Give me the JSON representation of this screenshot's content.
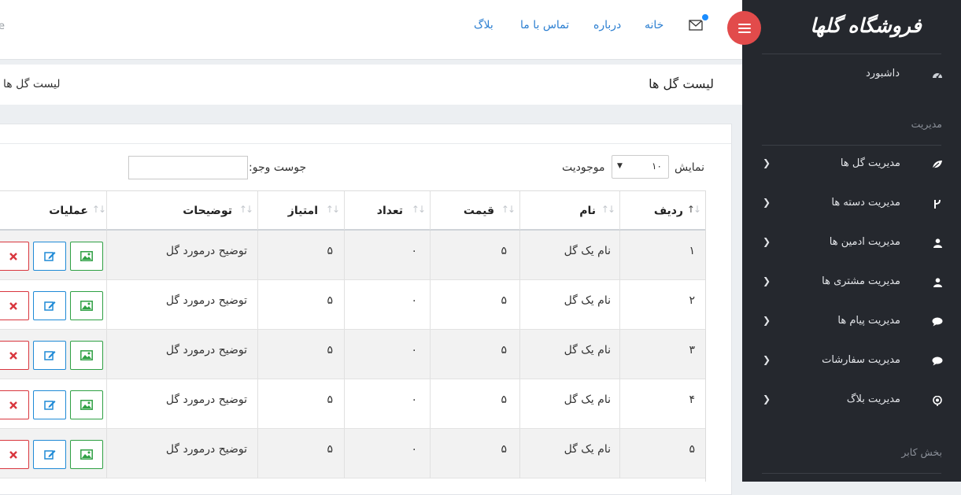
{
  "brand": {
    "name": "فروشگاه گلها"
  },
  "sidebar": {
    "dashboard": "داشبورد",
    "section_manage": "مدیریت",
    "items": [
      {
        "label": "مدیریت گل ها",
        "icon": "leaf-icon"
      },
      {
        "label": "مدیریت دسته ها",
        "icon": "fork-icon"
      },
      {
        "label": "مدیریت ادمین ها",
        "icon": "user-icon"
      },
      {
        "label": "مدیریت مشتری ها",
        "icon": "user-icon"
      },
      {
        "label": "مدیریت پیام ها",
        "icon": "chat-bubble-icon"
      },
      {
        "label": "مدیریت سفارشات",
        "icon": "chat-bubble-icon"
      },
      {
        "label": "مدیریت بلاگ",
        "icon": "location-pin-icon"
      }
    ],
    "section_user": "بخش کابر"
  },
  "topbar": {
    "nav": [
      "خانه",
      "درباره",
      "تماس با ما",
      "بلاگ"
    ],
    "search_fragment": "e"
  },
  "page": {
    "title": "لیست گل ها",
    "breadcrumb": "لیست گل ها"
  },
  "table_controls": {
    "show": "نمایش",
    "length_value": "۱۰",
    "entries": "موجودیت",
    "search_label": "جوست وجو:"
  },
  "table": {
    "headers": [
      "ردیف",
      "نام",
      "قیمت",
      "تعداد",
      "امتیاز",
      "توضیحات",
      "عملیات"
    ],
    "rows": [
      [
        "۱",
        "نام یک گل",
        "۵",
        "۰",
        "۵",
        "توضیح درمورد گل"
      ],
      [
        "۲",
        "نام یک گل",
        "۵",
        "۰",
        "۵",
        "توضیح درمورد گل"
      ],
      [
        "۳",
        "نام یک گل",
        "۵",
        "۰",
        "۵",
        "توضیح درمورد گل"
      ],
      [
        "۴",
        "نام یک گل",
        "۵",
        "۰",
        "۵",
        "توضیح درمورد گل"
      ],
      [
        "۵",
        "نام یک گل",
        "۵",
        "۰",
        "۵",
        "توضیح درمورد گل"
      ]
    ]
  },
  "colors": {
    "sidebar_bg": "#25282e",
    "accent_red": "#e24b4b",
    "link_blue": "#2c7fd1",
    "btn_green": "#2ea043",
    "btn_blue": "#1f8ad6",
    "btn_red": "#d9363e"
  }
}
